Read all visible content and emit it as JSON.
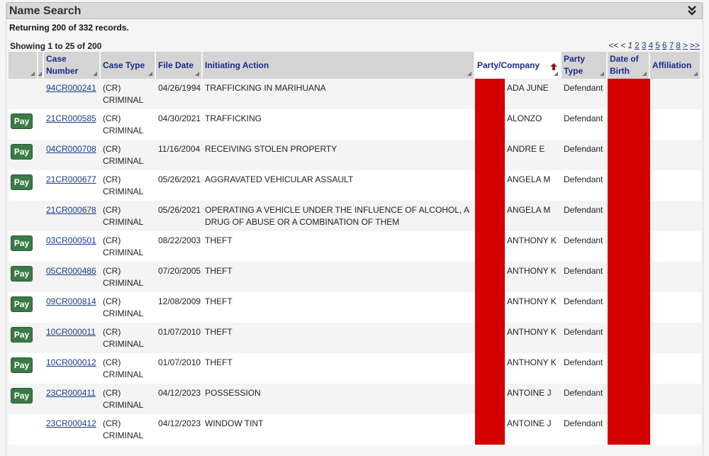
{
  "panel": {
    "title": "Name Search",
    "collapse_icon": "double-chevron-down-icon"
  },
  "summary": {
    "returning": "Returning 200 of 332 records.",
    "showing": "Showing 1 to 25 of 200"
  },
  "pager": {
    "first": "<<",
    "prev": "<",
    "current": "1",
    "pages": [
      "2",
      "3",
      "4",
      "5",
      "6",
      "7",
      "8"
    ],
    "next": ">",
    "last": ">>"
  },
  "table": {
    "columns": [
      {
        "key": "pay",
        "label": ""
      },
      {
        "key": "sel",
        "label": ""
      },
      {
        "key": "case_number",
        "label": "Case Number"
      },
      {
        "key": "case_type",
        "label": "Case Type"
      },
      {
        "key": "file_date",
        "label": "File Date"
      },
      {
        "key": "initiating_action",
        "label": "Initiating Action"
      },
      {
        "key": "party_redacted",
        "label": ""
      },
      {
        "key": "party_company",
        "label": "Party/Company",
        "sorted": "ascending"
      },
      {
        "key": "party_type",
        "label": "Party Type"
      },
      {
        "key": "dob",
        "label": "Date of Birth"
      },
      {
        "key": "affiliation",
        "label": "Affiliation"
      }
    ],
    "pay_label": "Pay",
    "redaction_color": "#d40000",
    "rows": [
      {
        "pay": false,
        "case_number": "94CR000241",
        "case_type_1": "(CR)",
        "case_type_2": "CRIMINAL",
        "file_date": "04/26/1994",
        "initiating_action": "TRAFFICKING IN MARIHUANA",
        "party": "ADA JUNE",
        "party_type": "Defendant",
        "affiliation": ""
      },
      {
        "pay": true,
        "case_number": "21CR000585",
        "case_type_1": "(CR)",
        "case_type_2": "CRIMINAL",
        "file_date": "04/30/2021",
        "initiating_action": "TRAFFICKING",
        "party": "ALONZO",
        "party_type": "Defendant",
        "affiliation": ""
      },
      {
        "pay": true,
        "case_number": "04CR000708",
        "case_type_1": "(CR)",
        "case_type_2": "CRIMINAL",
        "file_date": "11/16/2004",
        "initiating_action": "RECEIVING STOLEN PROPERTY",
        "party": "ANDRE E",
        "party_type": "Defendant",
        "affiliation": ""
      },
      {
        "pay": true,
        "case_number": "21CR000677",
        "case_type_1": "(CR)",
        "case_type_2": "CRIMINAL",
        "file_date": "05/26/2021",
        "initiating_action": "AGGRAVATED VEHICULAR ASSAULT",
        "party": "ANGELA M",
        "party_type": "Defendant",
        "affiliation": ""
      },
      {
        "pay": false,
        "case_number": "21CR000678",
        "case_type_1": "(CR)",
        "case_type_2": "CRIMINAL",
        "file_date": "05/26/2021",
        "initiating_action": "OPERATING A VEHICLE UNDER THE INFLUENCE OF ALCOHOL, A DRUG OF ABUSE OR A COMBINATION OF THEM",
        "party": "ANGELA M",
        "party_type": "Defendant",
        "affiliation": ""
      },
      {
        "pay": true,
        "case_number": "03CR000501",
        "case_type_1": "(CR)",
        "case_type_2": "CRIMINAL",
        "file_date": "08/22/2003",
        "initiating_action": "THEFT",
        "party": "ANTHONY K",
        "party_type": "Defendant",
        "affiliation": ""
      },
      {
        "pay": true,
        "case_number": "05CR000486",
        "case_type_1": "(CR)",
        "case_type_2": "CRIMINAL",
        "file_date": "07/20/2005",
        "initiating_action": "THEFT",
        "party": "ANTHONY K",
        "party_type": "Defendant",
        "affiliation": ""
      },
      {
        "pay": true,
        "case_number": "09CR000814",
        "case_type_1": "(CR)",
        "case_type_2": "CRIMINAL",
        "file_date": "12/08/2009",
        "initiating_action": "THEFT",
        "party": "ANTHONY K",
        "party_type": "Defendant",
        "affiliation": ""
      },
      {
        "pay": true,
        "case_number": "10CR000011",
        "case_type_1": "(CR)",
        "case_type_2": "CRIMINAL",
        "file_date": "01/07/2010",
        "initiating_action": "THEFT",
        "party": "ANTHONY K",
        "party_type": "Defendant",
        "affiliation": ""
      },
      {
        "pay": true,
        "case_number": "10CR000012",
        "case_type_1": "(CR)",
        "case_type_2": "CRIMINAL",
        "file_date": "01/07/2010",
        "initiating_action": "THEFT",
        "party": "ANTHONY K",
        "party_type": "Defendant",
        "affiliation": ""
      },
      {
        "pay": true,
        "case_number": "23CR000411",
        "case_type_1": "(CR)",
        "case_type_2": "CRIMINAL",
        "file_date": "04/12/2023",
        "initiating_action": "POSSESSION",
        "party": "ANTOINE J",
        "party_type": "Defendant",
        "affiliation": ""
      },
      {
        "pay": false,
        "case_number": "23CR000412",
        "case_type_1": "(CR)",
        "case_type_2": "CRIMINAL",
        "file_date": "04/12/2023",
        "initiating_action": "WINDOW TINT",
        "party": "ANTOINE J",
        "party_type": "Defendant",
        "affiliation": ""
      }
    ]
  }
}
